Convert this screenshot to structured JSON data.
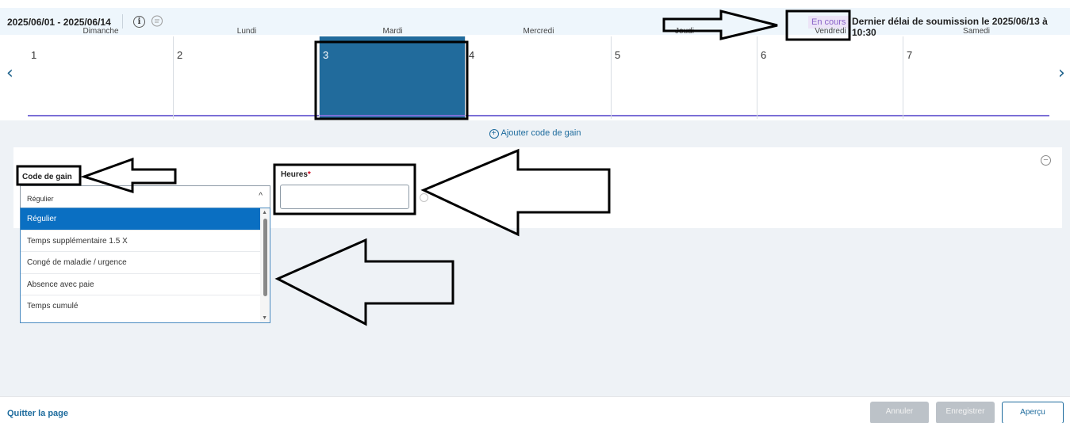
{
  "header": {
    "period": "2025/06/01 - 2025/06/14",
    "status": "En cours",
    "deadline": "Dernier délai de soumission le 2025/06/13 à 10:30",
    "info_icon": "info-icon",
    "comment_icon": "comment-icon"
  },
  "days": [
    {
      "name": "Dimanche",
      "num": "1"
    },
    {
      "name": "Lundi",
      "num": "2"
    },
    {
      "name": "Mardi",
      "num": "3"
    },
    {
      "name": "Mercredi",
      "num": "4"
    },
    {
      "name": "Jeudi",
      "num": "5"
    },
    {
      "name": "Vendredi",
      "num": "6"
    },
    {
      "name": "Samedi",
      "num": "7"
    }
  ],
  "nav": {
    "prev": "‹",
    "next": "›"
  },
  "content": {
    "add_earning_label": "Ajouter code de gain",
    "earning_code_label": "Code de gain",
    "hours_label": "Heures",
    "hours_required_mark": "*",
    "hours_value": "",
    "selected_earning_code": "Régulier",
    "earning_options": [
      "Régulier",
      "Temps supplémentaire 1.5 X",
      "Congé de maladie / urgence",
      "Absence avec paie",
      "Temps cumulé"
    ]
  },
  "footer": {
    "quit": "Quitter la page",
    "cancel": "Annuler",
    "save": "Enregistrer",
    "preview": "Aperçu"
  },
  "colors": {
    "accent": "#1d6b9d",
    "selected_day": "#216b9c",
    "selected_option": "#0a6fc2",
    "status": "#8a63c9",
    "required": "#d0021b"
  }
}
